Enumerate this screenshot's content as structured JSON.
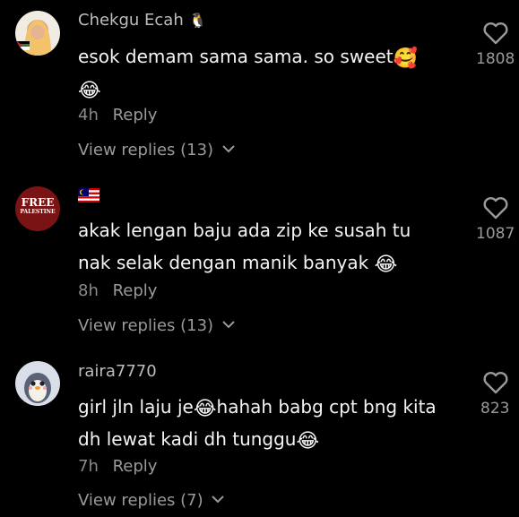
{
  "comments": [
    {
      "username": "Chekgu Ecah",
      "badge_icon": "penguin-icon",
      "text_line1": "esok demam sama sama. so sweet",
      "emoji1": "🥰",
      "emoji2": "😂",
      "time": "4h",
      "reply_label": "Reply",
      "replies_label": "View replies (13)",
      "likes": "1808"
    },
    {
      "username": "",
      "flag_icon": "malaysia-flag-icon",
      "avatar_text1": "FREE",
      "avatar_text2": "PALESTINE",
      "text_line1": "akak lengan baju ada zip ke susah tu",
      "text_line2": "nak selak dengan manik banyak",
      "emoji1": "😂",
      "time": "8h",
      "reply_label": "Reply",
      "replies_label": "View replies (13)",
      "likes": "1087"
    },
    {
      "username": "raira7770",
      "text_line1a": "girl jln laju je",
      "text_line1b": "hahah babg cpt bng kita",
      "text_line2": "dh lewat kadi dh tunggu",
      "emoji1": "😂",
      "emoji2": "😂",
      "time": "7h",
      "reply_label": "Reply",
      "replies_label": "View replies (7)",
      "likes": "823"
    }
  ],
  "colors": {
    "background": "#000000",
    "secondary_text": "#9a9a9a",
    "avatar2_bg": "#7a1414"
  }
}
